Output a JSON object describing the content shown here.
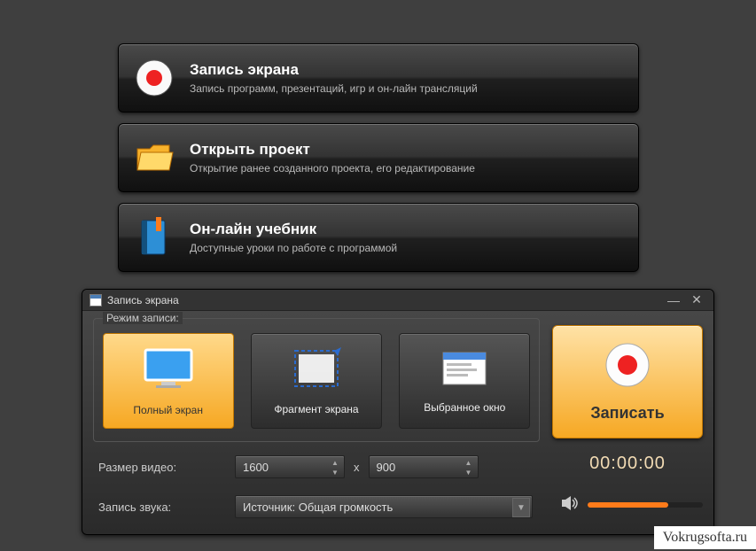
{
  "menu": [
    {
      "title": "Запись экрана",
      "desc": "Запись программ, презентаций, игр и он-лайн трансляций"
    },
    {
      "title": "Открыть проект",
      "desc": "Открытие ранее созданного проекта, его редактирование"
    },
    {
      "title": "Он-лайн учебник",
      "desc": "Доступные уроки по работе с программой"
    }
  ],
  "panel": {
    "title": "Запись экрана",
    "mode_group_label": "Режим записи:",
    "modes": {
      "fullscreen": "Полный экран",
      "fragment": "Фрагмент экрана",
      "window": "Выбранное окно"
    },
    "record_label": "Записать",
    "timer": "00:00:00",
    "size_label": "Размер видео:",
    "size_x": "x",
    "width": "1600",
    "height": "900",
    "audio_label": "Запись звука:",
    "audio_source": "Источник: Общая громкость"
  },
  "watermark": "Vokrugsofta.ru"
}
